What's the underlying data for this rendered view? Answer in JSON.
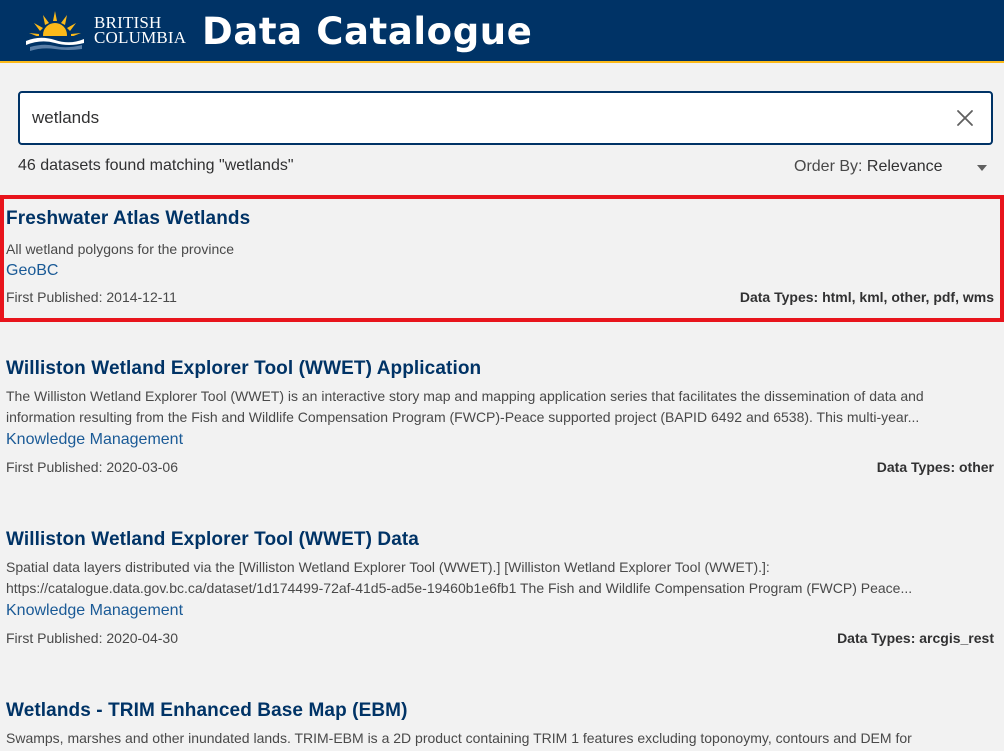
{
  "header": {
    "logo_line1": "BRITISH",
    "logo_line2": "COLUMBIA",
    "title": "Data Catalogue",
    "colors": {
      "background": "#003366",
      "accent": "#fcba19"
    }
  },
  "search": {
    "value": "wetlands",
    "clear_icon": "close-icon"
  },
  "results_summary": "46 datasets found matching \"wetlands\"",
  "order_by": {
    "label": "Order By:",
    "value": "Relevance"
  },
  "results": [
    {
      "title": "Freshwater Atlas Wetlands",
      "description": "All wetland polygons for the province",
      "organization": "GeoBC",
      "first_published": "First Published: 2014-12-11",
      "data_types": "Data Types: html, kml, other, pdf, wms",
      "highlighted": true
    },
    {
      "title": "Williston Wetland Explorer Tool (WWET) Application",
      "description": "The Williston Wetland Explorer Tool (WWET) is an interactive story map and mapping application series that facilitates the dissemination of data and information resulting from the Fish and Wildlife Compensation Program (FWCP)-Peace supported project (BAPID 6492 and 6538). This multi-year...",
      "organization": "Knowledge Management",
      "first_published": "First Published: 2020-03-06",
      "data_types": "Data Types: other"
    },
    {
      "title": "Williston Wetland Explorer Tool (WWET) Data",
      "description": "Spatial data layers distributed via the [Williston Wetland Explorer Tool (WWET).] [Williston Wetland Explorer Tool (WWET).]: https://catalogue.data.gov.bc.ca/dataset/1d174499-72af-41d5-ad5e-19460b1e6fb1 The Fish and Wildlife Compensation Program (FWCP) Peace...",
      "organization": "Knowledge Management",
      "first_published": "First Published: 2020-04-30",
      "data_types": "Data Types: arcgis_rest"
    },
    {
      "title": "Wetlands - TRIM Enhanced Base Map (EBM)",
      "description": "Swamps, marshes and other inundated lands. TRIM-EBM is a 2D product containing TRIM 1 features excluding toponoymy, contours and DEM for"
    }
  ]
}
